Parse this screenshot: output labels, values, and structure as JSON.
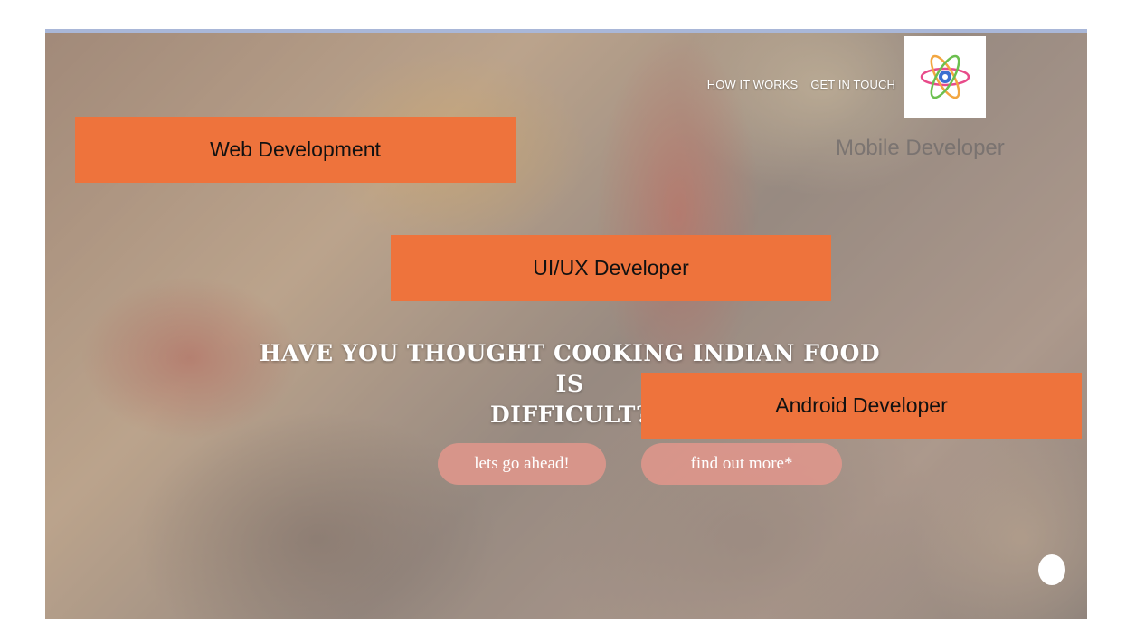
{
  "nav": {
    "how_it_works": "HOW IT WORKS",
    "get_in_touch": "GET IN TOUCH"
  },
  "ghost_label": "Mobile Developer",
  "tags": {
    "web": "Web Development",
    "uiux": "UI/UX Developer",
    "android": "Android Developer"
  },
  "hero": {
    "title_line1": "HAVE YOU THOUGHT COOKING INDIAN FOOD IS",
    "title_line2": "DIFFICULT?",
    "primary_button": "lets go ahead!",
    "secondary_button": "find out more*"
  },
  "colors": {
    "tag_orange": "#ee733c",
    "button_pink": "#e2968c",
    "nav_text": "#ffffff"
  },
  "icons": {
    "logo": "atom-flower-logo",
    "scroll": "white-dot"
  }
}
